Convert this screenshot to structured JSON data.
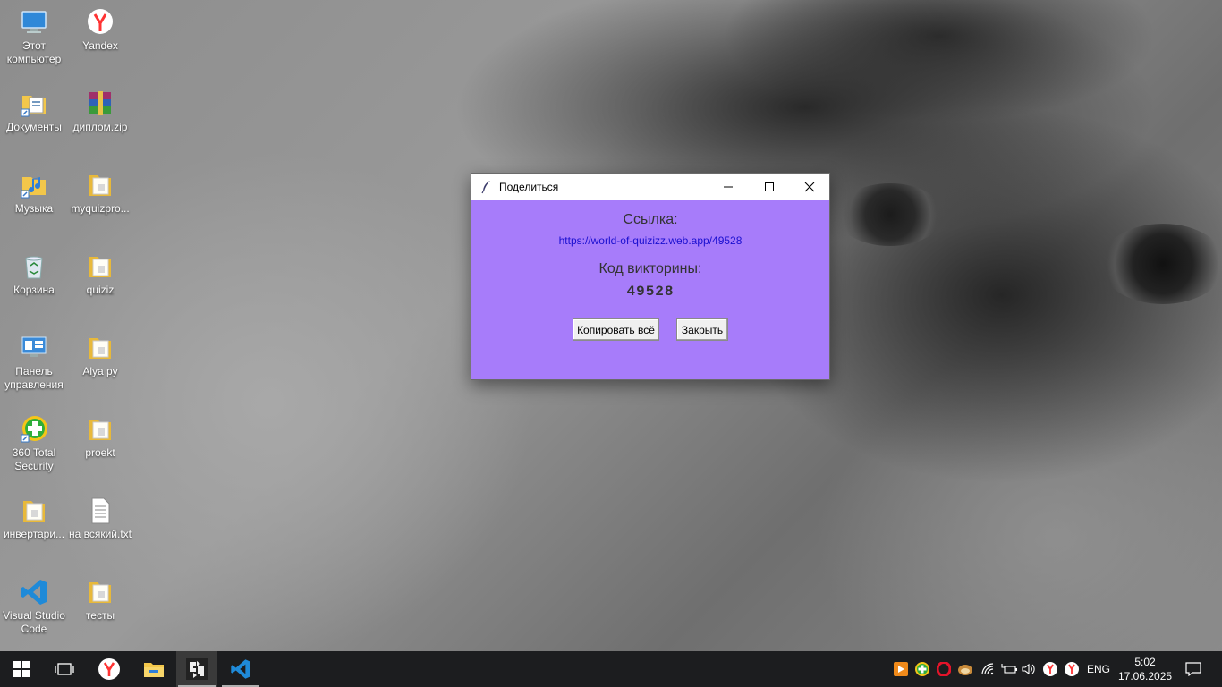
{
  "desktop": {
    "icons": [
      {
        "label": "Этот компьютер",
        "icon": "computer-icon"
      },
      {
        "label": "Yandex",
        "icon": "yandex-browser-icon"
      },
      {
        "label": "Документы",
        "icon": "documents-folder-icon"
      },
      {
        "label": "диплом.zip",
        "icon": "winrar-archive-icon"
      },
      {
        "label": "Музыка",
        "icon": "music-folder-icon"
      },
      {
        "label": "myquizpro...",
        "icon": "folder-icon"
      },
      {
        "label": "Корзина",
        "icon": "recycle-bin-icon"
      },
      {
        "label": "quiziz",
        "icon": "folder-icon"
      },
      {
        "label": "Панель управления",
        "icon": "control-panel-icon"
      },
      {
        "label": "Alya py",
        "icon": "folder-icon"
      },
      {
        "label": "360 Total Security",
        "icon": "360-security-icon"
      },
      {
        "label": "proekt",
        "icon": "folder-icon"
      },
      {
        "label": "инвертари...",
        "icon": "folder-icon"
      },
      {
        "label": "на всякий.txt",
        "icon": "text-file-icon"
      },
      {
        "label": "Visual Studio Code",
        "icon": "vscode-icon"
      },
      {
        "label": "тесты",
        "icon": "folder-icon"
      }
    ]
  },
  "dialog": {
    "title": "Поделиться",
    "link_heading": "Ссылка:",
    "link_url": "https://world-of-quizizz.web.app/49528",
    "code_heading": "Код викторины:",
    "code_value": "49528",
    "copy_button": "Копировать всё",
    "close_button": "Закрыть",
    "background_color": "#a77cfa",
    "link_color": "#1a0fd0"
  },
  "taskbar": {
    "apps": [
      {
        "name": "start-button",
        "icon": "windows-logo-icon"
      },
      {
        "name": "task-view-button",
        "icon": "task-view-icon"
      },
      {
        "name": "yandex-browser",
        "icon": "yandex-browser-icon"
      },
      {
        "name": "file-explorer",
        "icon": "folder-icon"
      },
      {
        "name": "python-tk-app",
        "icon": "tk-app-icon",
        "active": true
      },
      {
        "name": "visual-studio-code",
        "icon": "vscode-icon",
        "running": true
      }
    ],
    "tray": {
      "language": "ENG",
      "time": "5:02",
      "date": "17.06.2025",
      "icons": [
        "media-player-icon",
        "360-security-icon",
        "opera-icon",
        "hamster-icon",
        "wifi-icon",
        "battery-icon",
        "volume-icon",
        "yandex-icon",
        "yandex-icon",
        "notification-icon"
      ]
    }
  }
}
